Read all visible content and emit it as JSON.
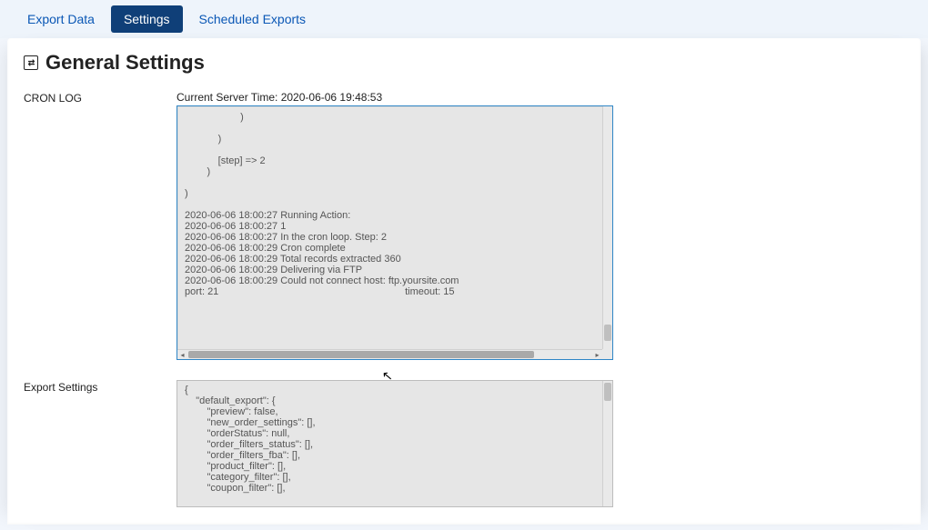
{
  "tabs": {
    "export_data": "Export Data",
    "settings": "Settings",
    "scheduled_exports": "Scheduled Exports"
  },
  "title_icon": "⇄",
  "page_title": "General Settings",
  "cron_log": {
    "label": "CRON LOG",
    "server_time_label": "Current Server Time: 2020-06-06 19:48:53",
    "content": "                    )\n\n            )\n\n            [step] => 2\n        )\n\n)\n\n2020-06-06 18:00:27 Running Action:\n2020-06-06 18:00:27 1\n2020-06-06 18:00:27 In the cron loop. Step: 2\n2020-06-06 18:00:29 Cron complete\n2020-06-06 18:00:29 Total records extracted 360\n2020-06-06 18:00:29 Delivering via FTP\n2020-06-06 18:00:29 Could not connect host: ftp.yoursite.com\nport: 21                                                                   timeout: 15"
  },
  "export_settings": {
    "label": "Export Settings",
    "content": "{\n    \"default_export\": {\n        \"preview\": false,\n        \"new_order_settings\": [],\n        \"orderStatus\": null,\n        \"order_filters_status\": [],\n        \"order_filters_fba\": [],\n        \"product_filter\": [],\n        \"category_filter\": [],\n        \"coupon_filter\": [],"
  }
}
